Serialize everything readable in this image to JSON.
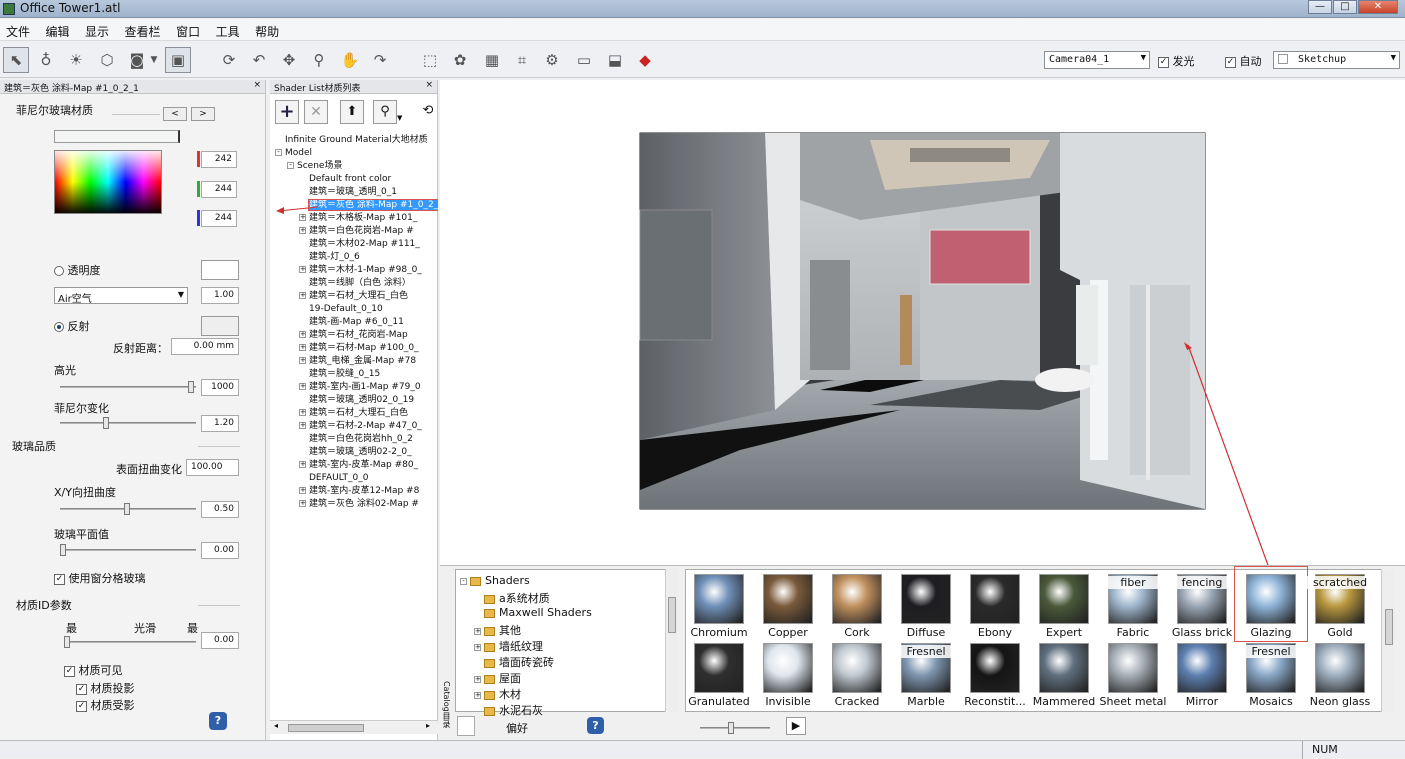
{
  "window": {
    "title": "Office Tower1.atl",
    "minimize": "—",
    "maximize": "□",
    "close": "✕"
  },
  "menu": [
    "文件",
    "编辑",
    "显示",
    "查看栏",
    "窗口",
    "工具",
    "帮助"
  ],
  "toolbar": {
    "camera": "Camera04_1",
    "glow_label": "发光",
    "glow_checked": true,
    "auto_label": "自动",
    "auto_checked": true,
    "render_mode": "Sketchup"
  },
  "left_panel": {
    "header": "建筑＝灰色 涂料-Map #1_0_2_1",
    "section_title": "菲尼尔玻璃材质",
    "nav_prev": "<",
    "nav_next": ">",
    "rgb": {
      "r": "242",
      "g": "244",
      "b": "244"
    },
    "transparency_label": "透明度",
    "medium_select": "Air空气",
    "medium_value": "1.00",
    "reflection_label": "反射",
    "reflection_distance_label": "反射距离：",
    "reflection_distance_value": "0.00 mm",
    "highlight_label": "高光",
    "highlight_value": "1000",
    "fresnel_label": "菲尼尔变化",
    "fresnel_value": "1.20",
    "glass_quality_label": "玻璃品质",
    "surface_distortion_label": "表面扭曲变化",
    "surface_distortion_value": "100.00",
    "xy_distortion_label": "X/Y向扭曲度",
    "xy_distortion_value": "0.50",
    "glass_plane_label": "玻璃平面值",
    "glass_plane_value": "0.00",
    "use_window_glass_label": "使用窗分格玻璃",
    "material_id_label": "材质ID参数",
    "id_min_label": "最",
    "id_smooth_label": "光滑",
    "id_max_label": "最",
    "id_value": "0.00",
    "visible_label": "材质可见",
    "cast_shadow_label": "材质投影",
    "receive_shadow_label": "材质受影",
    "help": "?"
  },
  "shader_list": {
    "header": "Shader List材质列表",
    "items": [
      {
        "label": "Infinite Ground Material大地材质",
        "indent": 0,
        "expander": ""
      },
      {
        "label": "Model",
        "indent": 0,
        "expander": "-"
      },
      {
        "label": "Scene场景",
        "indent": 1,
        "expander": "-"
      },
      {
        "label": "Default front color",
        "indent": 2,
        "expander": ""
      },
      {
        "label": "建筑＝玻璃_透明_0_1",
        "indent": 2,
        "expander": ""
      },
      {
        "label": "建筑＝灰色 涂料-Map #1_0_2_1",
        "indent": 2,
        "expander": "",
        "selected": true
      },
      {
        "label": "建筑＝木格板-Map #101_",
        "indent": 2,
        "expander": "+"
      },
      {
        "label": "建筑＝白色花岗岩-Map #",
        "indent": 2,
        "expander": "+"
      },
      {
        "label": "建筑＝木材02-Map #111_",
        "indent": 2,
        "expander": ""
      },
      {
        "label": "建筑-灯_0_6",
        "indent": 2,
        "expander": ""
      },
      {
        "label": "建筑＝木材-1-Map #98_0_",
        "indent": 2,
        "expander": "+"
      },
      {
        "label": "建筑＝线脚（白色 涂料）",
        "indent": 2,
        "expander": ""
      },
      {
        "label": "建筑＝石材_大理石_白色",
        "indent": 2,
        "expander": "+"
      },
      {
        "label": "19-Default_0_10",
        "indent": 2,
        "expander": ""
      },
      {
        "label": "建筑-画-Map #6_0_11",
        "indent": 2,
        "expander": ""
      },
      {
        "label": "建筑＝石材_花岗岩-Map",
        "indent": 2,
        "expander": "+"
      },
      {
        "label": "建筑＝石材-Map #100_0_",
        "indent": 2,
        "expander": "+"
      },
      {
        "label": "建筑_电梯_金属-Map #78",
        "indent": 2,
        "expander": "+"
      },
      {
        "label": "建筑＝胶缝_0_15",
        "indent": 2,
        "expander": ""
      },
      {
        "label": "建筑-室内-画1-Map #79_0",
        "indent": 2,
        "expander": "+"
      },
      {
        "label": "建筑＝玻璃_透明02_0_19",
        "indent": 2,
        "expander": ""
      },
      {
        "label": "建筑＝石材_大理石_白色",
        "indent": 2,
        "expander": "+"
      },
      {
        "label": "建筑＝石材-2-Map #47_0_",
        "indent": 2,
        "expander": "+"
      },
      {
        "label": "建筑＝白色花岗岩hh_0_2",
        "indent": 2,
        "expander": ""
      },
      {
        "label": "建筑＝玻璃_透明02-2_0_",
        "indent": 2,
        "expander": ""
      },
      {
        "label": "建筑-室内-皮革-Map #80_",
        "indent": 2,
        "expander": "+"
      },
      {
        "label": "DEFAULT_0_0",
        "indent": 2,
        "expander": ""
      },
      {
        "label": "建筑-室内-皮革12-Map #8",
        "indent": 2,
        "expander": "+"
      },
      {
        "label": "建筑＝灰色 涂料02-Map #",
        "indent": 2,
        "expander": "+"
      }
    ]
  },
  "catalog": {
    "side_label": "Catalog目录",
    "tree": [
      {
        "label": "Shaders",
        "indent": 0,
        "expander": "-"
      },
      {
        "label": "a系统材质",
        "indent": 1,
        "expander": ""
      },
      {
        "label": "Maxwell Shaders",
        "indent": 1,
        "expander": ""
      },
      {
        "label": "其他",
        "indent": 1,
        "expander": "+"
      },
      {
        "label": "墙纸纹理",
        "indent": 1,
        "expander": "+"
      },
      {
        "label": "墙面砖瓷砖",
        "indent": 1,
        "expander": ""
      },
      {
        "label": "屋面",
        "indent": 1,
        "expander": "+"
      },
      {
        "label": "木材",
        "indent": 1,
        "expander": "+"
      },
      {
        "label": "水泥石灰",
        "indent": 1,
        "expander": ""
      }
    ],
    "bottom_label": "偏好",
    "row1": [
      {
        "name": "Chromium",
        "top": "",
        "color": "#6f8fb7"
      },
      {
        "name": "Copper",
        "top": "",
        "color": "#7a5a3a"
      },
      {
        "name": "Cork",
        "top": "",
        "color": "#c0905e"
      },
      {
        "name": "Diffuse",
        "top": "",
        "color": "#1e1e22"
      },
      {
        "name": "Ebony",
        "top": "",
        "color": "#2a2a2a"
      },
      {
        "name": "Expert",
        "top": "",
        "color": "#4a5a3a"
      },
      {
        "name": "Fabric",
        "top": "fiber",
        "color": "#9fb6cc"
      },
      {
        "name": "Glass brick",
        "top": "fencing",
        "color": "#9aa6b5"
      },
      {
        "name": "Glazing",
        "top": "",
        "color": "#8fb4d8",
        "highlight": true
      },
      {
        "name": "Gold",
        "top": "scratched",
        "color": "#b8973e"
      }
    ],
    "row2": [
      {
        "name": "Granulated",
        "top": "",
        "color": "#2f2f2f"
      },
      {
        "name": "Invisible",
        "top": "",
        "color": "#dfe6ee"
      },
      {
        "name": "Cracked",
        "top": "",
        "color": "#c0c8d0"
      },
      {
        "name": "Marble",
        "top": "Fresnel",
        "color": "#7f96b0"
      },
      {
        "name": "Reconstit...",
        "top": "",
        "color": "#151515"
      },
      {
        "name": "Mammered",
        "top": "",
        "color": "#60707f"
      },
      {
        "name": "Sheet metal",
        "top": "",
        "color": "#a8b0b8"
      },
      {
        "name": "Mirror",
        "top": "",
        "color": "#5d7fb0"
      },
      {
        "name": "Mosaics",
        "top": "Fresnel",
        "color": "#8aa8c8"
      },
      {
        "name": "Neon glass",
        "top": "",
        "color": "#9fb0c0"
      }
    ]
  },
  "status": {
    "num": "NUM"
  },
  "colors": {
    "highlight": "#d9534f",
    "selection": "#3399ff",
    "arrow": "#d03030"
  }
}
